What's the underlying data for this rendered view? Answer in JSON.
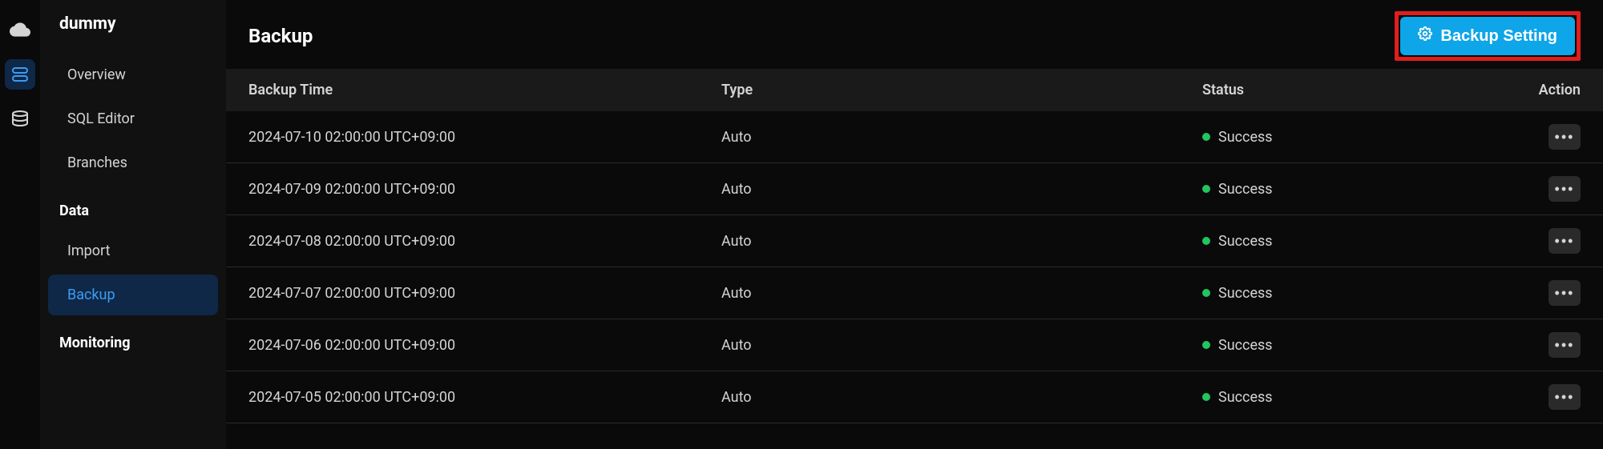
{
  "project_name": "dummy",
  "sidebar": {
    "items": [
      {
        "label": "Overview",
        "active": false
      },
      {
        "label": "SQL Editor",
        "active": false
      },
      {
        "label": "Branches",
        "active": false
      }
    ],
    "data_section_label": "Data",
    "data_items": [
      {
        "label": "Import",
        "active": false
      },
      {
        "label": "Backup",
        "active": true
      }
    ],
    "monitoring_section_label": "Monitoring"
  },
  "page": {
    "title": "Backup",
    "backup_setting_label": "Backup Setting"
  },
  "table": {
    "headers": {
      "time": "Backup Time",
      "type": "Type",
      "status": "Status",
      "action": "Action"
    },
    "rows": [
      {
        "time": "2024-07-10 02:00:00 UTC+09:00",
        "type": "Auto",
        "status": "Success"
      },
      {
        "time": "2024-07-09 02:00:00 UTC+09:00",
        "type": "Auto",
        "status": "Success"
      },
      {
        "time": "2024-07-08 02:00:00 UTC+09:00",
        "type": "Auto",
        "status": "Success"
      },
      {
        "time": "2024-07-07 02:00:00 UTC+09:00",
        "type": "Auto",
        "status": "Success"
      },
      {
        "time": "2024-07-06 02:00:00 UTC+09:00",
        "type": "Auto",
        "status": "Success"
      },
      {
        "time": "2024-07-05 02:00:00 UTC+09:00",
        "type": "Auto",
        "status": "Success"
      }
    ]
  }
}
